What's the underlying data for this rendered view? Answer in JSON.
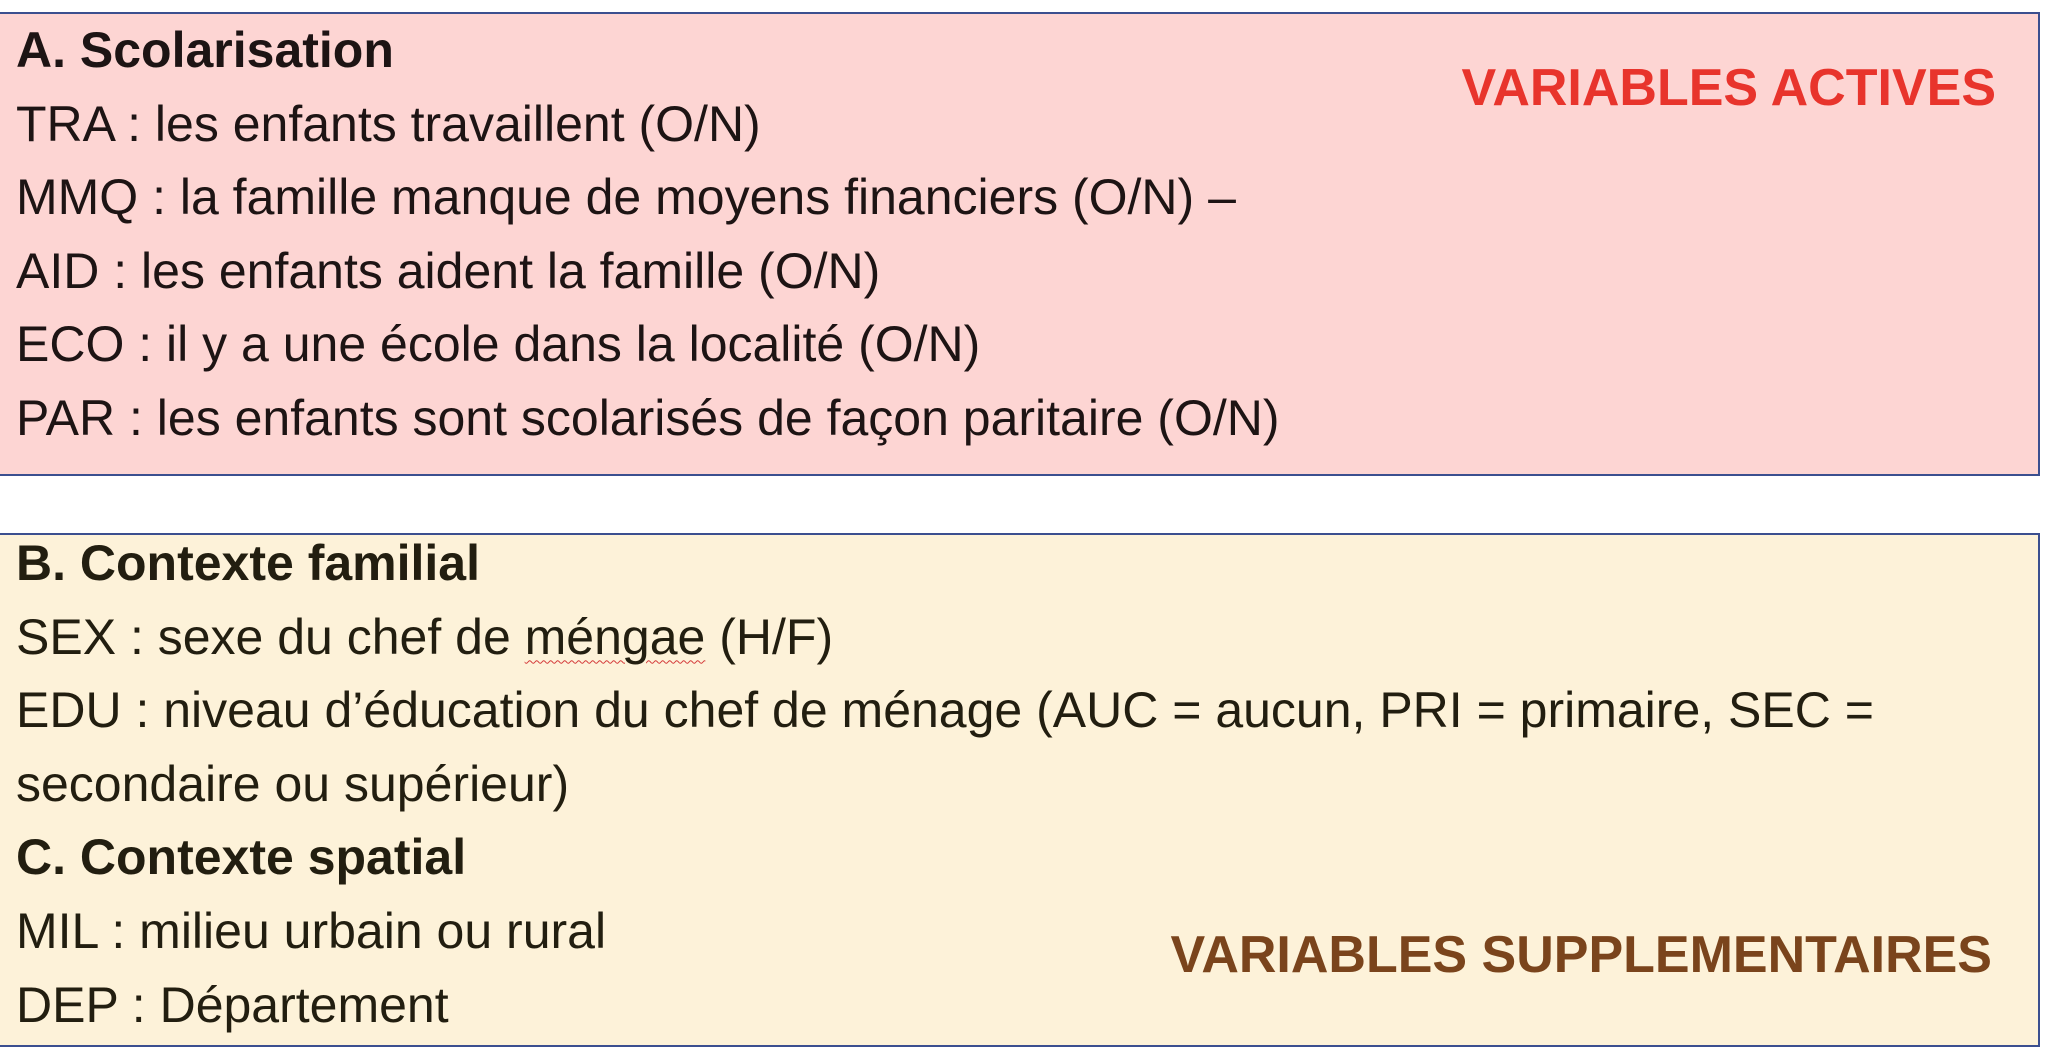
{
  "section_a": {
    "heading": "A. Scolarisation",
    "tag": "VARIABLES ACTIVES",
    "lines": [
      "TRA : les enfants travaillent (O/N)",
      "MMQ : la famille manque de moyens financiers (O/N) –",
      "AID : les enfants aident la famille (O/N)",
      "ECO : il y a une école dans la localité (O/N)",
      "PAR : les enfants sont scolarisés de façon paritaire (O/N)"
    ]
  },
  "section_b": {
    "heading": "B. Contexte familial",
    "sex_prefix": "SEX : sexe du chef de ",
    "sex_typo": "méngae",
    "sex_suffix": " (H/F)",
    "edu_line": "EDU : niveau d’éducation du chef de ménage (AUC = aucun, PRI = primaire, SEC = secondaire ou supérieur)"
  },
  "section_c": {
    "heading": "C. Contexte spatial",
    "tag": "VARIABLES SUPPLEMENTAIRES",
    "lines": [
      "MIL : milieu urbain ou rural",
      "DEP : Département"
    ]
  },
  "colors": {
    "box_a_bg": "#fdd5d3",
    "box_b_bg": "#fdf2d9",
    "border": "#3b4f8f",
    "tag_active": "#e8342c",
    "tag_supplementary": "#7a441c"
  }
}
